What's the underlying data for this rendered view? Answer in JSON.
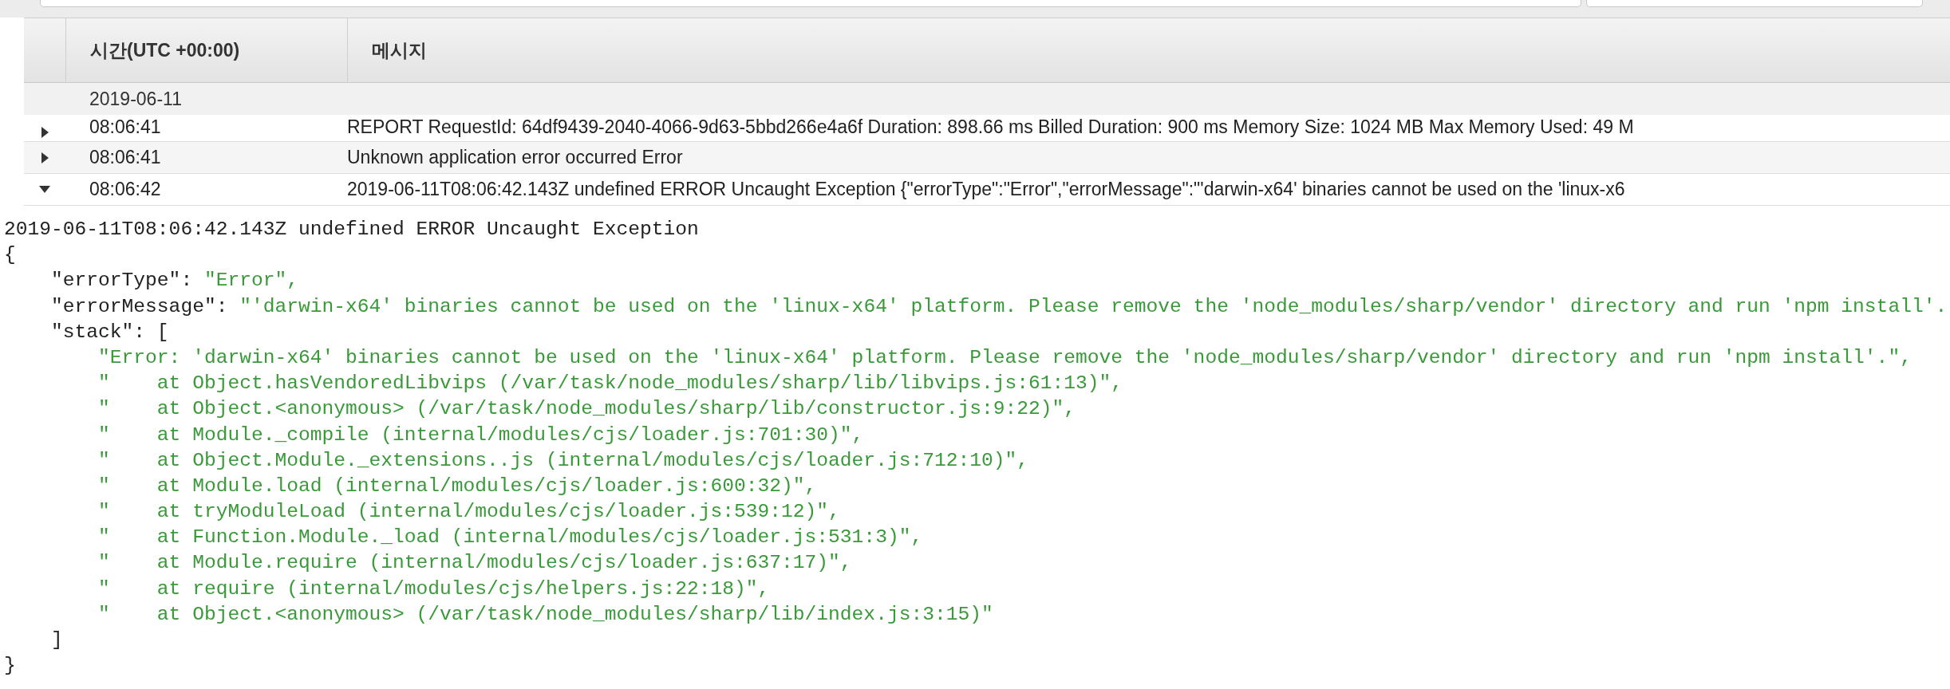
{
  "table": {
    "columns": [
      "시간(UTC +00:00)",
      "메시지"
    ],
    "date_group": "2019-06-11",
    "rows": [
      {
        "time": "08:06:41",
        "message": "REPORT RequestId: 64df9439-2040-4066-9d63-5bbd266e4a6f Duration: 898.66 ms Billed Duration: 900 ms Memory Size: 1024 MB Max Memory Used: 49 M",
        "expanded": false
      },
      {
        "time": "08:06:41",
        "message": "Unknown application error occurred Error",
        "expanded": false
      },
      {
        "time": "08:06:42",
        "message": "2019-06-11T08:06:42.143Z undefined ERROR Uncaught Exception {\"errorType\":\"Error\",\"errorMessage\":\"'darwin-x64' binaries cannot be used on the 'linux-x6",
        "expanded": true
      }
    ]
  },
  "detail": {
    "header": "2019-06-11T08:06:42.143Z undefined ERROR Uncaught Exception",
    "open": "{",
    "fields": [
      {
        "key": "\"errorType\": ",
        "value": "\"Error\","
      },
      {
        "key": "\"errorMessage\": ",
        "value": "\"'darwin-x64' binaries cannot be used on the 'linux-x64' platform. Please remove the 'node_modules/sharp/vendor' directory and run 'npm install'."
      }
    ],
    "stack": {
      "key": "\"stack\": ",
      "open": "[",
      "items": [
        "\"Error: 'darwin-x64' binaries cannot be used on the 'linux-x64' platform. Please remove the 'node_modules/sharp/vendor' directory and run 'npm install'.\",",
        "\"    at Object.hasVendoredLibvips (/var/task/node_modules/sharp/lib/libvips.js:61:13)\",",
        "\"    at Object.<anonymous> (/var/task/node_modules/sharp/lib/constructor.js:9:22)\",",
        "\"    at Module._compile (internal/modules/cjs/loader.js:701:30)\",",
        "\"    at Object.Module._extensions..js (internal/modules/cjs/loader.js:712:10)\",",
        "\"    at Module.load (internal/modules/cjs/loader.js:600:32)\",",
        "\"    at tryModuleLoad (internal/modules/cjs/loader.js:539:12)\",",
        "\"    at Function.Module._load (internal/modules/cjs/loader.js:531:3)\",",
        "\"    at Module.require (internal/modules/cjs/loader.js:637:17)\",",
        "\"    at require (internal/modules/cjs/helpers.js:22:18)\",",
        "\"    at Object.<anonymous> (/var/task/node_modules/sharp/lib/index.js:3:15)\""
      ],
      "close": "]"
    },
    "close": "}"
  }
}
